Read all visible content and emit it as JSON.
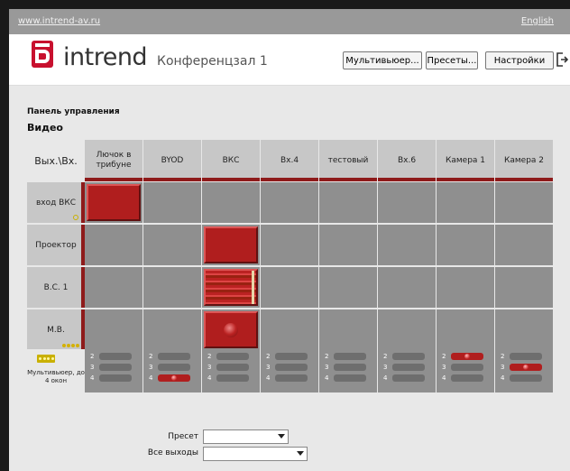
{
  "topbar": {
    "site_link": "www.intrend-av.ru",
    "language_link": "English"
  },
  "header": {
    "logo_text": "intrend",
    "room_title": "Конференцзал 1",
    "buttons": {
      "multiviewer": "Мультивьюер...",
      "presets": "Пресеты...",
      "settings": "Настройки"
    }
  },
  "colors": {
    "accent": "#8e1b1b",
    "active": "#b01e1e",
    "cell": "#8f8f8f",
    "header_cell": "#c7c7c7"
  },
  "panel": {
    "title": "Панель управления",
    "section": "Видео",
    "corner": "Вых.\\Вх."
  },
  "inputs": [
    "Лючок в трибуне",
    "BYOD",
    "ВКС",
    "Вх.4",
    "тестовый",
    "Вх.6",
    "Камера 1",
    "Камера 2"
  ],
  "outputs": [
    "вход ВКС",
    "Проектор",
    "В.С. 1",
    "М.В."
  ],
  "routes": [
    {
      "output": "вход ВКС",
      "input": "Лючок в трибуне",
      "style": "solid"
    },
    {
      "output": "Проектор",
      "input": "ВКС",
      "style": "solid"
    },
    {
      "output": "В.С. 1",
      "input": "ВКС",
      "style": "video-wall"
    },
    {
      "output": "М.В.",
      "input": "ВКС",
      "style": "orb"
    }
  ],
  "multiviewer": {
    "label": "Мультивьюер, до 4 окон",
    "window_numbers": [
      "2",
      "3",
      "4"
    ],
    "active": [
      {
        "input": "BYOD",
        "window": "4"
      },
      {
        "input": "Камера 1",
        "window": "2"
      },
      {
        "input": "Камера 2",
        "window": "3"
      }
    ]
  },
  "controls": {
    "preset_label": "Пресет",
    "preset_value": "",
    "all_outputs_label": "Все выходы",
    "all_outputs_value": ""
  }
}
